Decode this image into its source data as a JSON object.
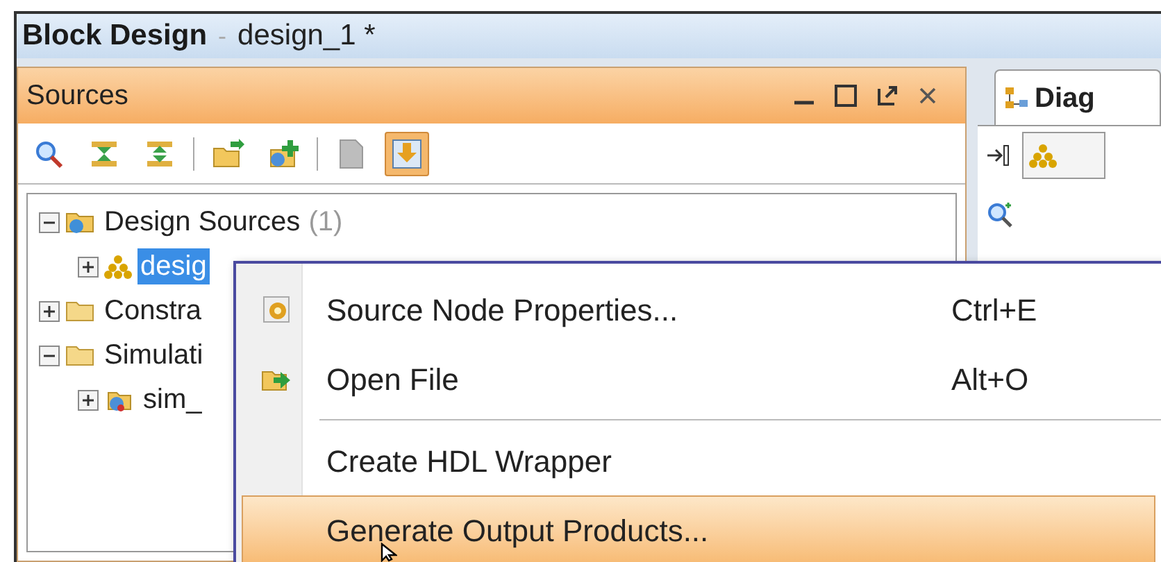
{
  "window": {
    "title": "Block Design",
    "separator": "-",
    "document": "design_1 *"
  },
  "sources_panel": {
    "title": "Sources",
    "toolbar": [
      {
        "kind": "search",
        "selected": false
      },
      {
        "kind": "collapse",
        "selected": false
      },
      {
        "kind": "expand",
        "selected": false
      },
      {
        "kind": "divider"
      },
      {
        "kind": "add-folder",
        "selected": false
      },
      {
        "kind": "add-source",
        "selected": false
      },
      {
        "kind": "divider"
      },
      {
        "kind": "file",
        "selected": false
      },
      {
        "kind": "download",
        "selected": true
      }
    ],
    "tree": [
      {
        "kind": "source-folder",
        "label": "Design Sources",
        "count": "(1)",
        "expanded": true,
        "selected": false,
        "children": [
          {
            "kind": "design",
            "label": "desig",
            "expanded": false,
            "selected": true
          }
        ]
      },
      {
        "kind": "folder",
        "label": "Constra",
        "expanded": false,
        "selected": false
      },
      {
        "kind": "folder",
        "label": "Simulati",
        "expanded": true,
        "selected": false,
        "children": [
          {
            "kind": "sim",
            "label": "sim_",
            "expanded": false,
            "selected": false
          }
        ]
      }
    ]
  },
  "diagram_panel": {
    "tab": "Diag"
  },
  "context_menu": {
    "items": [
      {
        "kind": "properties",
        "label": "Source Node Properties...",
        "shortcut": "Ctrl+E",
        "selected": false
      },
      {
        "kind": "open",
        "label": "Open File",
        "shortcut": "Alt+O",
        "selected": false
      },
      {
        "kind": "separator"
      },
      {
        "kind": "item",
        "label": "Create HDL Wrapper",
        "selected": false
      },
      {
        "kind": "item",
        "label": "Generate Output Products...",
        "selected": true
      }
    ]
  }
}
